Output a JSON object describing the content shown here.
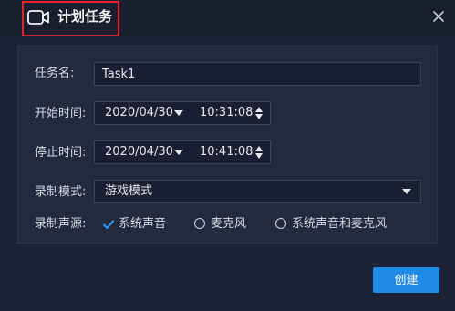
{
  "dialog": {
    "title": "计划任务",
    "close_icon": "close-icon",
    "title_icon": "video-camera-icon",
    "highlight_color": "#e0222b"
  },
  "form": {
    "task_name": {
      "label": "任务名:",
      "value": "Task1"
    },
    "start_time": {
      "label": "开始时间:",
      "date": "2020/04/30",
      "time": "10:31:08"
    },
    "stop_time": {
      "label": "停止时间:",
      "date": "2020/04/30",
      "time": "10:41:08"
    },
    "record_mode": {
      "label": "录制模式:",
      "selected": "游戏模式"
    },
    "audio_source": {
      "label": "录制声源:",
      "options": [
        {
          "label": "系统声音",
          "selected": true
        },
        {
          "label": "麦克风",
          "selected": false
        },
        {
          "label": "系统声音和麦克风",
          "selected": false
        }
      ]
    }
  },
  "actions": {
    "create_label": "创建",
    "accent_color": "#1e8ae6"
  }
}
